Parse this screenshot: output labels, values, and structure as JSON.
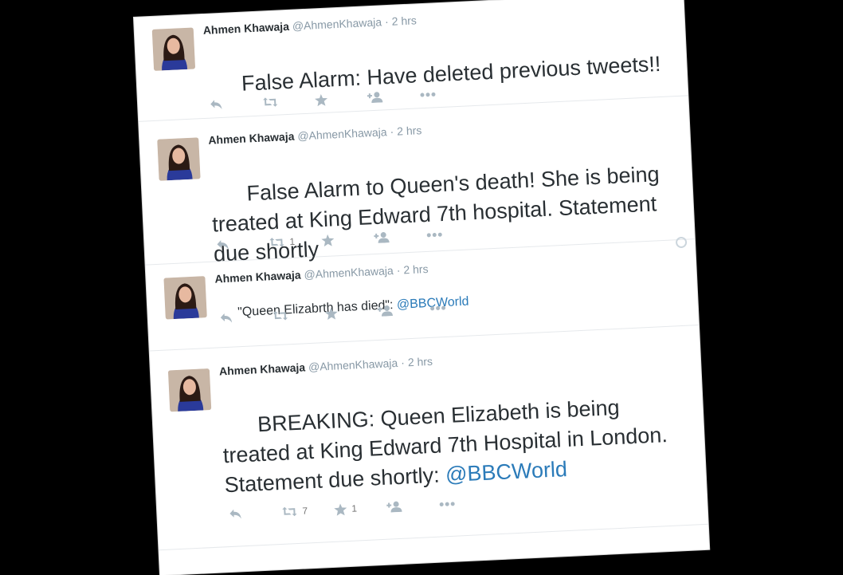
{
  "tweets": [
    {
      "name": "Ahmen Khawaja",
      "handle": "@AhmenKhawaja",
      "dot": "·",
      "time": "2 hrs",
      "text": "False Alarm: Have deleted previous tweets!!",
      "mention": "",
      "retweets": "",
      "favorites": ""
    },
    {
      "name": "Ahmen Khawaja",
      "handle": "@AhmenKhawaja",
      "dot": "·",
      "time": "2 hrs",
      "text": "False Alarm to Queen's death! She is being treated at King Edward 7th hospital. Statement due shortly",
      "mention": "",
      "retweets": "1",
      "favorites": ""
    },
    {
      "name": "Ahmen Khawaja",
      "handle": "@AhmenKhawaja",
      "dot": "·",
      "time": "2 hrs",
      "text": "\"Queen Elizabrth has died\": ",
      "mention": "@BBCWorld",
      "retweets": "",
      "favorites": ""
    },
    {
      "name": "Ahmen Khawaja",
      "handle": "@AhmenKhawaja",
      "dot": "·",
      "time": "2 hrs",
      "text": "BREAKING: Queen Elizabeth is being treated at King Edward 7th Hospital in London. Statement due shortly: ",
      "mention": "@BBCWorld",
      "retweets": "7",
      "favorites": "1"
    }
  ],
  "icons": {
    "reply": "reply-icon",
    "retweet": "retweet-icon",
    "favorite": "star-icon",
    "follow": "follow-icon",
    "more": "more-icon",
    "settings": "gear-icon"
  },
  "colors": {
    "link": "#2b7bb9",
    "icon": "#aab8c2",
    "name": "#292f33"
  }
}
